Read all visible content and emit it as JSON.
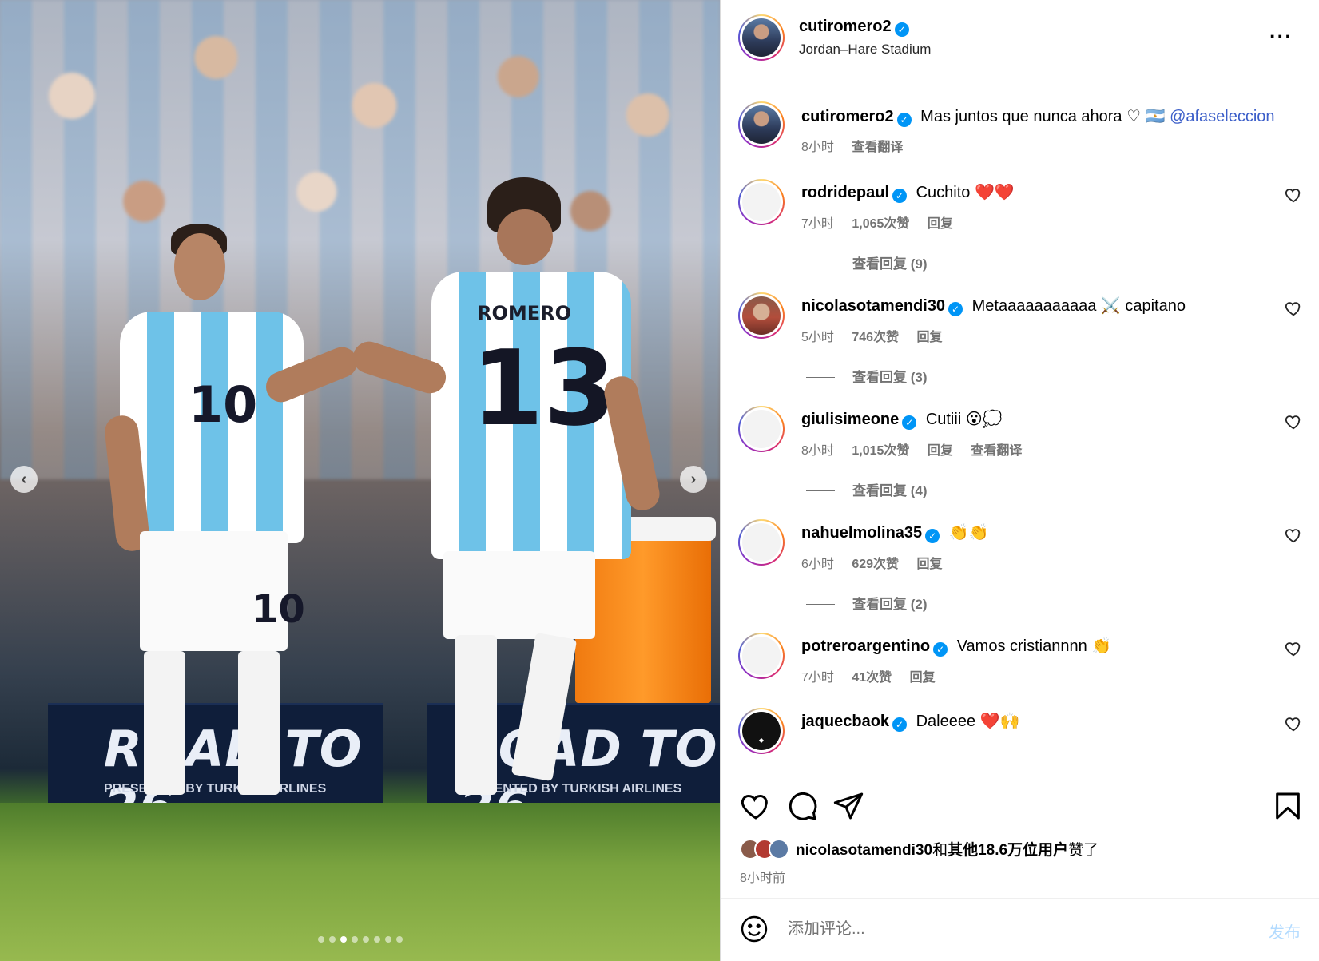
{
  "post": {
    "author": "cutiromero2",
    "location": "Jordan–Hare Stadium",
    "caption": "Mas juntos que nunca ahora ♡ 🇦🇷",
    "caption_mention": "@afaseleccion",
    "caption_time": "8小时",
    "caption_translate": "查看翻译"
  },
  "media": {
    "jersey_name": "ROMERO",
    "jersey_number_back": "13",
    "jersey_number_front": "10",
    "board_text": "ROAD TO 26",
    "board_sponsor": "PRESENTED BY TURKISH AIRLINES",
    "slide_index": 3,
    "slide_total": 8,
    "prev_icon": "chevron-left-icon",
    "next_icon": "chevron-right-icon"
  },
  "comments": [
    {
      "user": "rodridepaul",
      "text": "Cuchito ❤️❤️",
      "time": "7小时",
      "likes": "1,065次赞",
      "reply": "回复",
      "translate": "",
      "view_replies": "查看回复 (9)"
    },
    {
      "user": "nicolasotamendi30",
      "text": "Metaaaaaaaaaaa ⚔️ capitano",
      "time": "5小时",
      "likes": "746次赞",
      "reply": "回复",
      "translate": "",
      "view_replies": "查看回复 (3)"
    },
    {
      "user": "giulisimeone",
      "text": "Cutiii 😮💭",
      "time": "8小时",
      "likes": "1,015次赞",
      "reply": "回复",
      "translate": "查看翻译",
      "view_replies": "查看回复 (4)"
    },
    {
      "user": "nahuelmolina35",
      "text": "👏👏",
      "time": "6小时",
      "likes": "629次赞",
      "reply": "回复",
      "translate": "",
      "view_replies": "查看回复 (2)"
    },
    {
      "user": "potreroargentino",
      "text": "Vamos cristiannnn 👏",
      "time": "7小时",
      "likes": "41次赞",
      "reply": "回复",
      "translate": "",
      "view_replies": ""
    },
    {
      "user": "jaquecbaok",
      "text": "Daleeee ❤️🙌",
      "time": "",
      "likes": "",
      "reply": "",
      "translate": "",
      "view_replies": ""
    }
  ],
  "footer": {
    "liked_by_user": "nicolasotamendi30",
    "liked_by_and": "和",
    "liked_by_others": "其他18.6万位用户",
    "liked_by_suffix": "赞了",
    "time_ago": "8小时前",
    "comment_placeholder": "添加评论...",
    "post_button": "发布"
  },
  "icons": {
    "like": "heart-icon",
    "comment": "comment-bubble-icon",
    "share": "paper-plane-icon",
    "save": "bookmark-icon",
    "emoji": "smiley-icon",
    "more": "more-horizontal-icon",
    "verified": "verified-badge-icon"
  },
  "colors": {
    "verified": "#0095f6",
    "mention": "#3b5ec9",
    "muted_text": "#737373",
    "post_button_disabled": "#b3dbff"
  }
}
